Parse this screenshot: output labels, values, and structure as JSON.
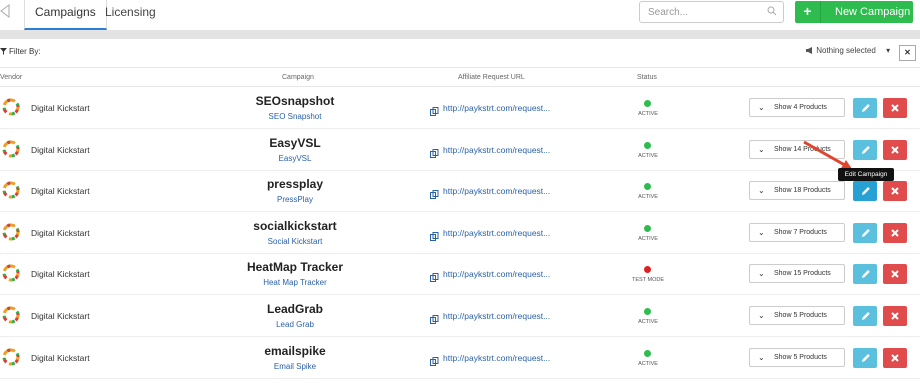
{
  "tabs": [
    {
      "label": "Campaigns"
    },
    {
      "label": "Licensing"
    }
  ],
  "search": {
    "placeholder": "Search..."
  },
  "new_button": {
    "label": "New Campaign"
  },
  "filter": {
    "label": "Filter By:",
    "select_value": "Nothing selected"
  },
  "columns": {
    "vendor": "Vendor",
    "campaign": "Campaign",
    "url": "Affiliate Request URL",
    "status": "Status"
  },
  "tooltip": "Edit Campaign",
  "colors": {
    "accent": "#2a7fd4",
    "green": "#2ebc4f",
    "active": "#2ebc4f",
    "test": "#e02020",
    "edit": "#5bc0de",
    "delete": "#e04b4b"
  },
  "rows": [
    {
      "vendor": "Digital Kickstart",
      "logo_text": "SEOsnapshot",
      "campaign": "SEO Snapshot",
      "url": "http://paykstrt.com/request...",
      "status": "ACTIVE",
      "status_color": "#2ebc4f",
      "products": "Show 4 Products"
    },
    {
      "vendor": "Digital Kickstart",
      "logo_text": "EasyVSL",
      "campaign": "EasyVSL",
      "url": "http://paykstrt.com/request...",
      "status": "ACTIVE",
      "status_color": "#2ebc4f",
      "products": "Show 14 Products"
    },
    {
      "vendor": "Digital Kickstart",
      "logo_text": "pressplay",
      "campaign": "PressPlay",
      "url": "http://paykstrt.com/request...",
      "status": "ACTIVE",
      "status_color": "#2ebc4f",
      "products": "Show 18 Products"
    },
    {
      "vendor": "Digital Kickstart",
      "logo_text": "socialkickstart",
      "campaign": "Social Kickstart",
      "url": "http://paykstrt.com/request...",
      "status": "ACTIVE",
      "status_color": "#2ebc4f",
      "products": "Show 7 Products"
    },
    {
      "vendor": "Digital Kickstart",
      "logo_text": "HeatMap Tracker",
      "campaign": "Heat Map Tracker",
      "url": "http://paykstrt.com/request...",
      "status": "TEST MODE",
      "status_color": "#e02020",
      "products": "Show 15 Products"
    },
    {
      "vendor": "Digital Kickstart",
      "logo_text": "LeadGrab",
      "campaign": "Lead Grab",
      "url": "http://paykstrt.com/request...",
      "status": "ACTIVE",
      "status_color": "#2ebc4f",
      "products": "Show 5 Products"
    },
    {
      "vendor": "Digital Kickstart",
      "logo_text": "emailspike",
      "campaign": "Email Spike",
      "url": "http://paykstrt.com/request...",
      "status": "ACTIVE",
      "status_color": "#2ebc4f",
      "products": "Show 5 Products"
    }
  ]
}
